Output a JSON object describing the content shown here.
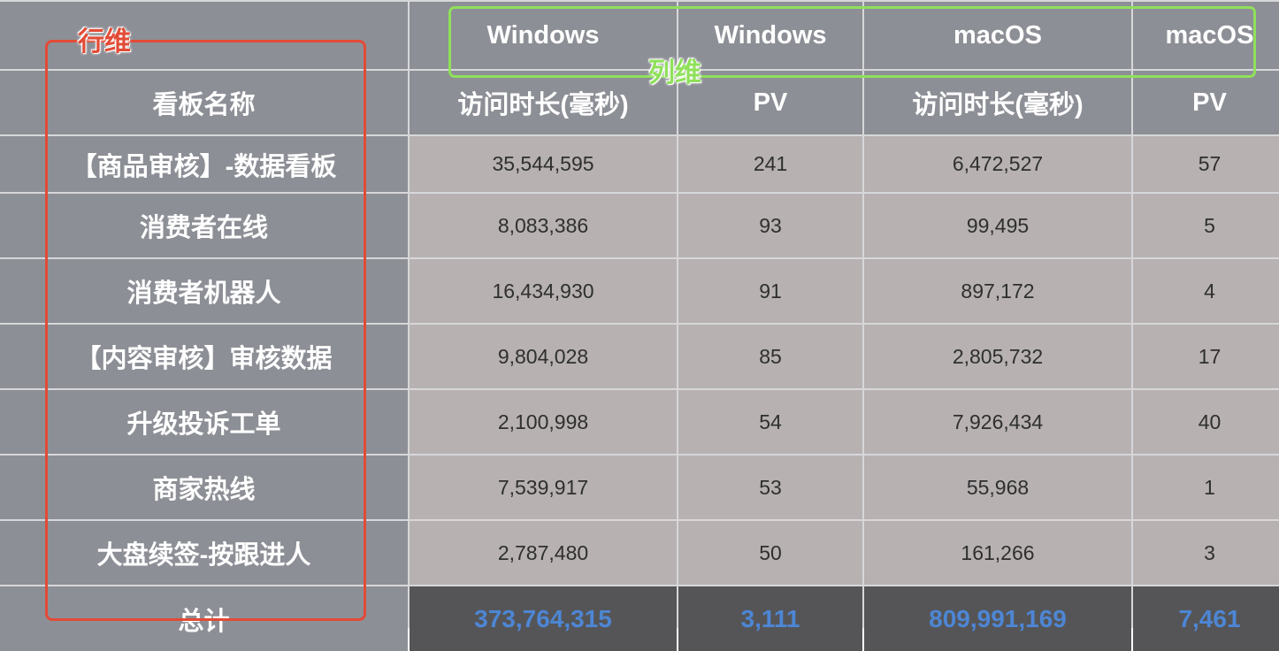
{
  "annotations": {
    "row_dim_label": "行维",
    "col_dim_label": "列维",
    "row_box_color": "#e24b36",
    "col_box_color": "#8fe05a"
  },
  "header": {
    "os": [
      "Windows",
      "Windows",
      "macOS",
      "macOS"
    ],
    "row_dim_title": "看板名称",
    "metrics": [
      "访问时长(毫秒)",
      "PV",
      "访问时长(毫秒)",
      "PV"
    ]
  },
  "rows": [
    {
      "name": "【商品审核】-数据看板",
      "values": [
        "35,544,595",
        "241",
        "6,472,527",
        "57"
      ]
    },
    {
      "name": "消费者在线",
      "values": [
        "8,083,386",
        "93",
        "99,495",
        "5"
      ]
    },
    {
      "name": "消费者机器人",
      "values": [
        "16,434,930",
        "91",
        "897,172",
        "4"
      ]
    },
    {
      "name": "【内容审核】审核数据",
      "values": [
        "9,804,028",
        "85",
        "2,805,732",
        "17"
      ]
    },
    {
      "name": "升级投诉工单",
      "values": [
        "2,100,998",
        "54",
        "7,926,434",
        "40"
      ]
    },
    {
      "name": "商家热线",
      "values": [
        "7,539,917",
        "53",
        "55,968",
        "1"
      ]
    },
    {
      "name": "大盘续签-按跟进人",
      "values": [
        "2,787,480",
        "50",
        "161,266",
        "3"
      ]
    }
  ],
  "total": {
    "label": "总计",
    "values": [
      "373,764,315",
      "3,111",
      "809,991,169",
      "7,461"
    ]
  },
  "colors": {
    "header_bg": "#8d8f96",
    "cell_bg": "#b7b1b1",
    "total_bg": "#555558",
    "total_text": "#4d86d4"
  }
}
